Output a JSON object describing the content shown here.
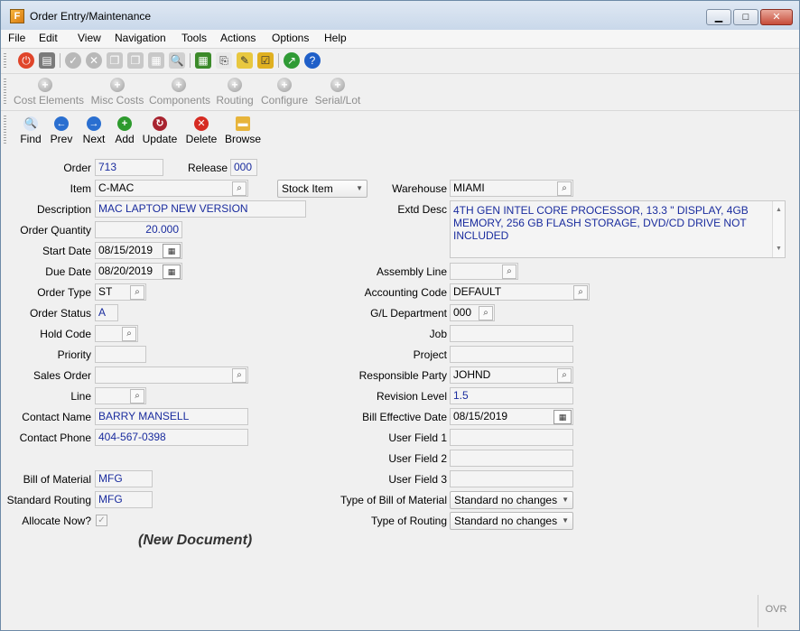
{
  "window": {
    "title": "Order Entry/Maintenance"
  },
  "menu": [
    "File",
    "Edit",
    "View",
    "Navigation",
    "Tools",
    "Actions",
    "Options",
    "Help"
  ],
  "toolbar2": [
    "Cost Elements",
    "Misc Costs",
    "Components",
    "Routing",
    "Configure",
    "Serial/Lot"
  ],
  "toolbar3": [
    "Find",
    "Prev",
    "Next",
    "Add",
    "Update",
    "Delete",
    "Browse"
  ],
  "form": {
    "order_label": "Order",
    "order": "713",
    "release_label": "Release",
    "release": "000",
    "item_label": "Item",
    "item": "C-MAC",
    "item_type": "Stock Item",
    "warehouse_label": "Warehouse",
    "warehouse": "MIAMI",
    "description_label": "Description",
    "description": "MAC LAPTOP  NEW VERSION",
    "extd_desc_label": "Extd Desc",
    "extd_desc": "4TH GEN INTEL CORE PROCESSOR, 13.3 \" DISPLAY, 4GB MEMORY, 256 GB FLASH STORAGE, DVD/CD DRIVE NOT INCLUDED",
    "order_qty_label": "Order Quantity",
    "order_qty": "20.000",
    "start_date_label": "Start Date",
    "start_date": "08/15/2019",
    "due_date_label": "Due Date",
    "due_date": "08/20/2019",
    "assembly_line_label": "Assembly Line",
    "assembly_line": "",
    "order_type_label": "Order Type",
    "order_type": "ST",
    "accounting_code_label": "Accounting Code",
    "accounting_code": "DEFAULT",
    "order_status_label": "Order Status",
    "order_status": "A",
    "gl_dept_label": "G/L Department",
    "gl_dept": "000",
    "hold_code_label": "Hold Code",
    "hold_code": "",
    "job_label": "Job",
    "job": "",
    "priority_label": "Priority",
    "priority": "",
    "project_label": "Project",
    "project": "",
    "sales_order_label": "Sales Order",
    "sales_order": "",
    "responsible_party_label": "Responsible Party",
    "responsible_party": "JOHND",
    "line_label": "Line",
    "line": "",
    "revision_level_label": "Revision Level",
    "revision_level": "1.5",
    "contact_name_label": "Contact Name",
    "contact_name": "BARRY MANSELL",
    "bill_eff_date_label": "Bill Effective Date",
    "bill_eff_date": "08/15/2019",
    "contact_phone_label": "Contact Phone",
    "contact_phone": "404-567-0398",
    "user_field1_label": "User Field 1",
    "user_field1": "",
    "user_field2_label": "User Field 2",
    "user_field2": "",
    "user_field3_label": "User Field 3",
    "user_field3": "",
    "bom_label": "Bill of Material",
    "bom": "MFG",
    "type_bom_label": "Type of Bill of Material",
    "type_bom": "Standard no changes",
    "std_routing_label": "Standard Routing",
    "std_routing": "MFG",
    "type_routing_label": "Type of Routing",
    "type_routing": "Standard no changes",
    "allocate_label": "Allocate Now?",
    "new_document": "(New Document)"
  },
  "status": {
    "ovr": "OVR"
  }
}
